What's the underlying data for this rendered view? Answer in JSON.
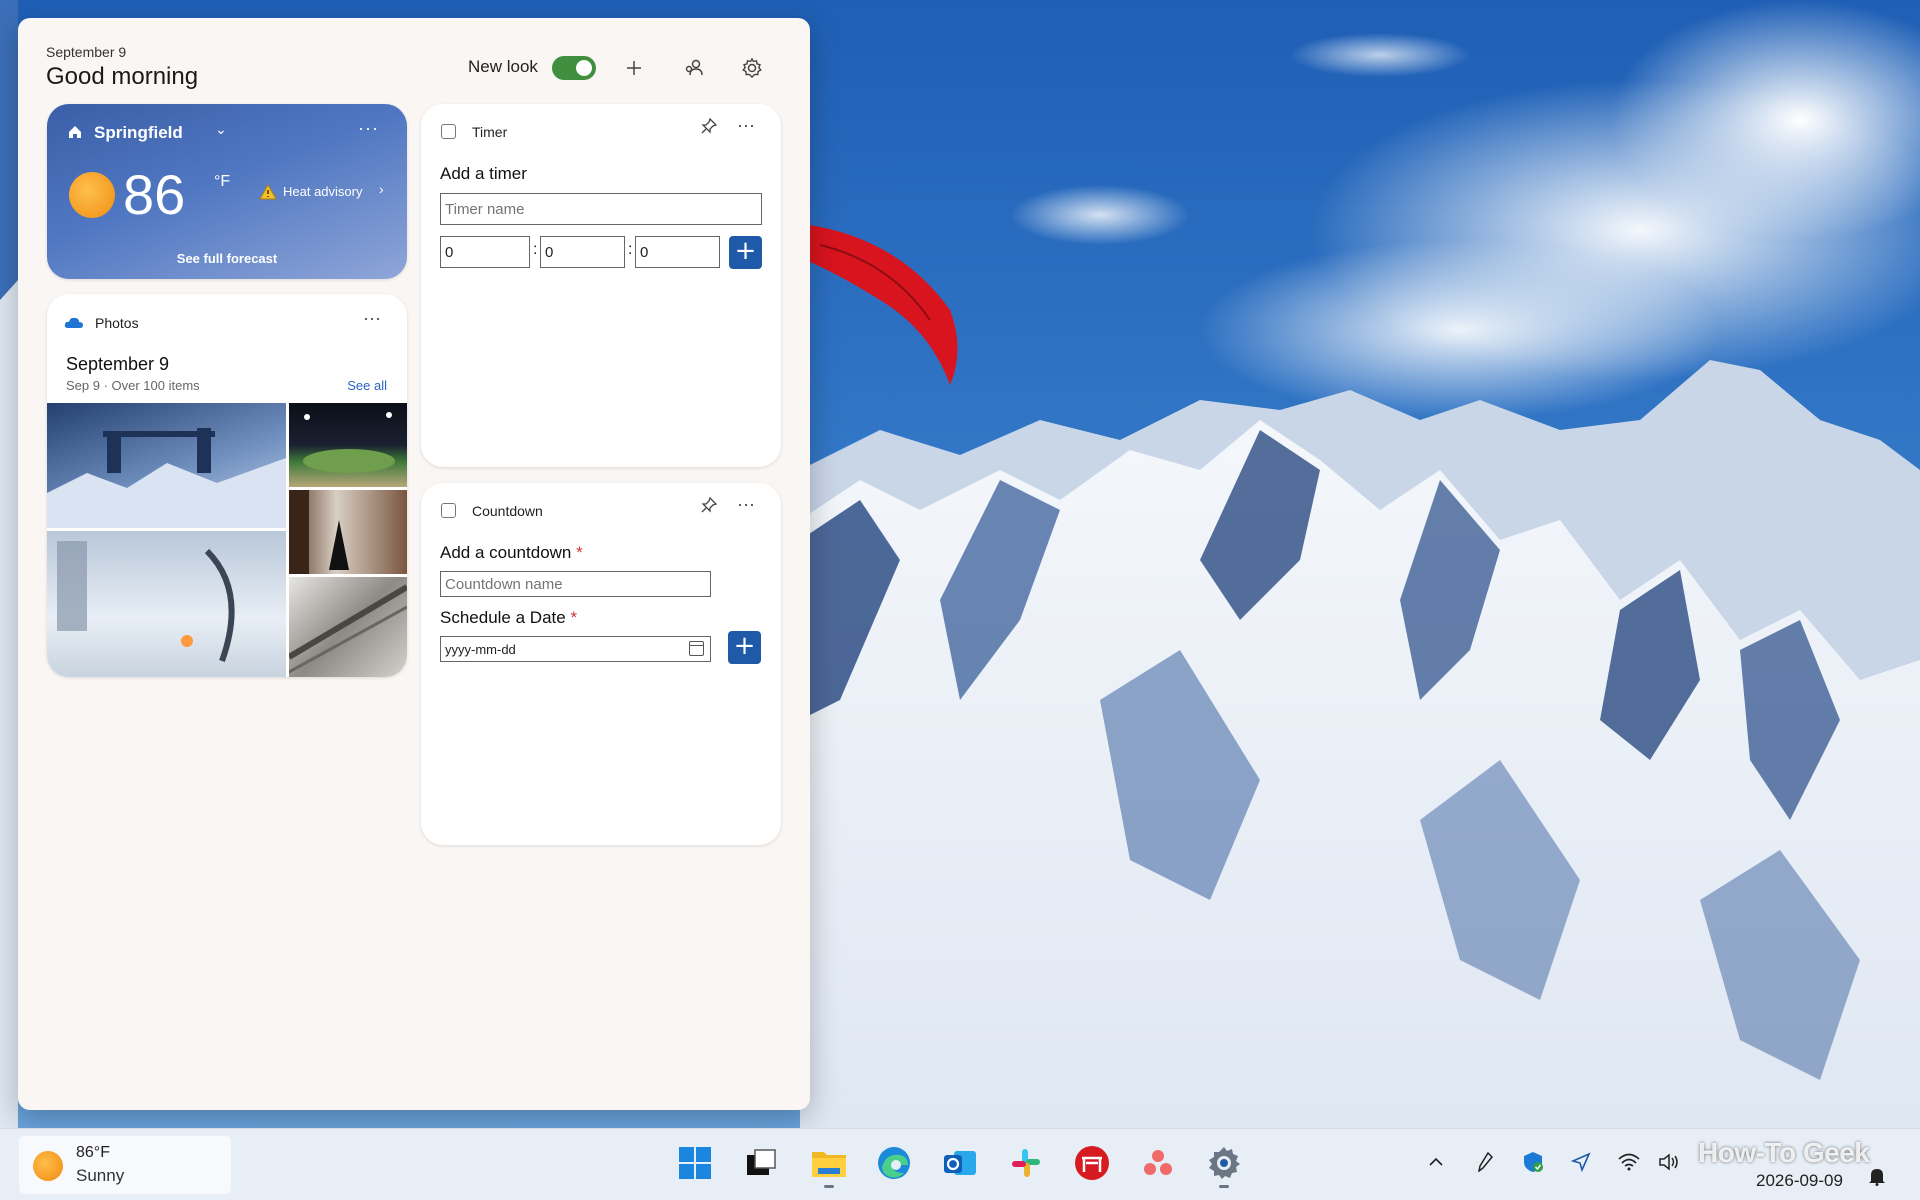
{
  "panel": {
    "date": "September 9",
    "greeting": "Good morning",
    "new_look_label": "New look"
  },
  "weather_widget": {
    "city": "Springfield",
    "temperature": "86",
    "unit": "°F",
    "alert": "Heat advisory",
    "forecast_link": "See full forecast"
  },
  "photos_widget": {
    "title": "Photos",
    "date_heading": "September 9",
    "subtitle": "Sep 9 · Over 100 items",
    "see_all": "See all"
  },
  "timer_widget": {
    "title": "Timer",
    "heading": "Add a timer",
    "name_placeholder": "Timer name",
    "hours": "0",
    "minutes": "0",
    "seconds": "0",
    "separator": ":"
  },
  "countdown_widget": {
    "title": "Countdown",
    "heading": "Add a countdown",
    "name_placeholder": "Countdown name",
    "date_heading": "Schedule a Date",
    "date_placeholder": "yyyy-mm-dd",
    "required_mark": "*"
  },
  "taskbar": {
    "weather_temp": "86°F",
    "weather_condition": "Sunny",
    "apps": [
      "start-icon",
      "task-view-icon",
      "file-explorer-icon",
      "edge-icon",
      "outlook-icon",
      "slack-icon",
      "red-app-icon",
      "asana-icon",
      "settings-icon"
    ],
    "date": "2026-09-09",
    "watermark": "How-To Geek"
  },
  "colors": {
    "accent": "#1f5aa8",
    "toggle_on": "#3f8f3f",
    "required": "#d13438",
    "link": "#2a66c1"
  }
}
